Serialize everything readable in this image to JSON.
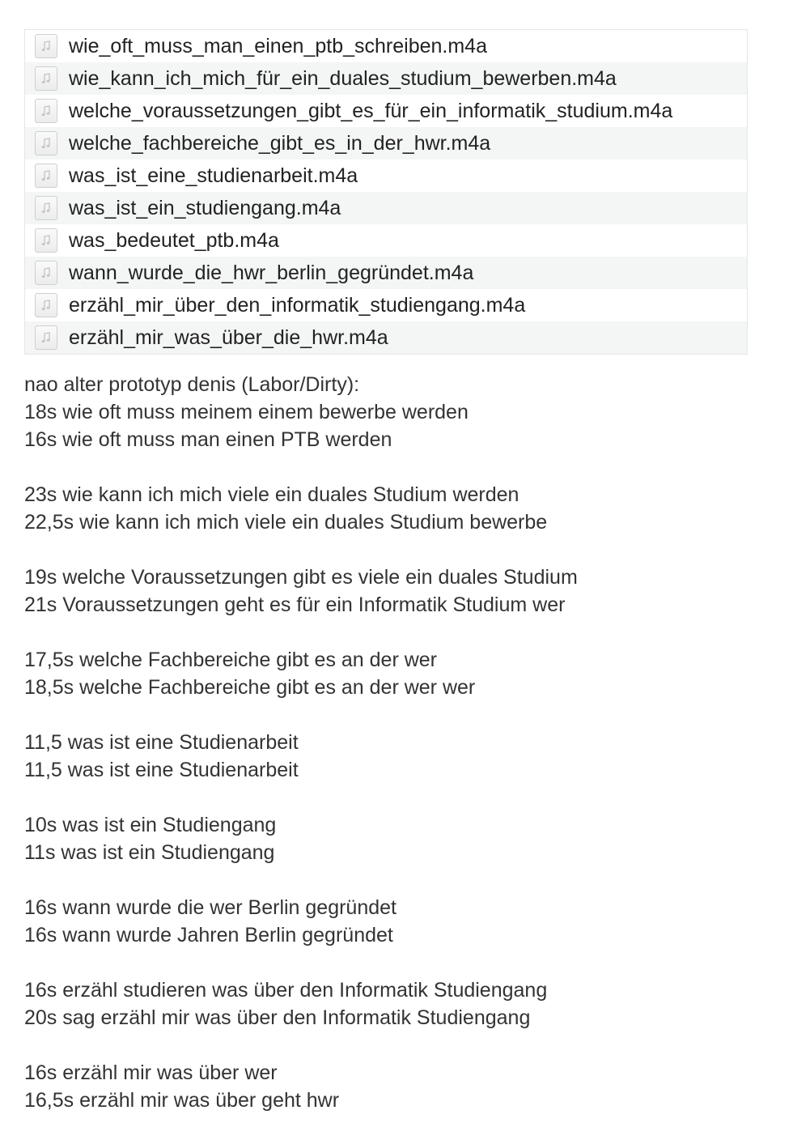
{
  "files": [
    {
      "name": "wie_oft_muss_man_einen_ptb_schreiben.m4a",
      "icon": "audio-file-icon"
    },
    {
      "name": "wie_kann_ich_mich_für_ein_duales_studium_bewerben.m4a",
      "icon": "audio-file-icon"
    },
    {
      "name": "welche_voraussetzungen_gibt_es_für_ein_informatik_studium.m4a",
      "icon": "audio-file-icon"
    },
    {
      "name": "welche_fachbereiche_gibt_es_in_der_hwr.m4a",
      "icon": "audio-file-icon"
    },
    {
      "name": "was_ist_eine_studienarbeit.m4a",
      "icon": "audio-file-icon"
    },
    {
      "name": "was_ist_ein_studiengang.m4a",
      "icon": "audio-file-icon"
    },
    {
      "name": "was_bedeutet_ptb.m4a",
      "icon": "audio-file-icon"
    },
    {
      "name": "wann_wurde_die_hwr_berlin_gegründet.m4a",
      "icon": "audio-file-icon"
    },
    {
      "name": "erzähl_mir_über_den_informatik_studiengang.m4a",
      "icon": "audio-file-icon"
    },
    {
      "name": "erzähl_mir_was_über_die_hwr.m4a",
      "icon": "audio-file-icon"
    }
  ],
  "notes": {
    "heading": "nao alter prototyp denis (Labor/Dirty):",
    "groups": [
      {
        "lines": [
          "18s wie oft muss meinem einem bewerbe werden",
          "16s wie oft muss man einen PTB werden"
        ]
      },
      {
        "lines": [
          "23s wie kann ich mich viele ein duales Studium werden",
          "22,5s wie kann ich mich viele ein duales Studium bewerbe"
        ]
      },
      {
        "lines": [
          "19s welche Voraussetzungen gibt es viele ein duales Studium",
          "21s Voraussetzungen geht es für ein Informatik Studium wer"
        ]
      },
      {
        "lines": [
          "17,5s welche Fachbereiche gibt es an der wer",
          "18,5s welche Fachbereiche gibt es an der wer wer"
        ]
      },
      {
        "lines": [
          "11,5 was ist eine Studienarbeit",
          "11,5 was ist eine Studienarbeit"
        ]
      },
      {
        "lines": [
          "10s was ist ein Studiengang",
          "11s was ist ein Studiengang"
        ]
      },
      {
        "lines": [
          "16s wann wurde die wer Berlin gegründet",
          "16s wann wurde Jahren Berlin gegründet"
        ]
      },
      {
        "lines": [
          "16s erzähl studieren was über den Informatik Studiengang",
          "20s sag erzähl mir was über den Informatik Studiengang"
        ]
      },
      {
        "lines": [
          "16s erzähl mir was über wer",
          "16,5s erzähl mir was über geht hwr"
        ]
      }
    ]
  }
}
